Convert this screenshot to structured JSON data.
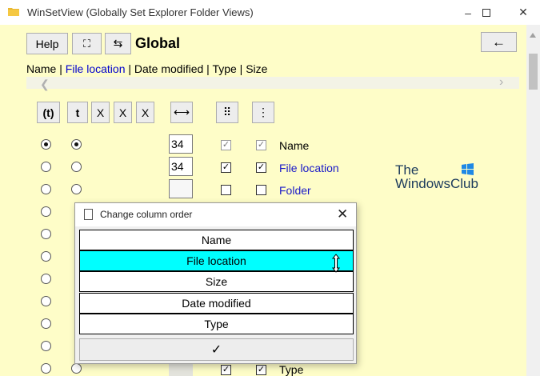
{
  "window": {
    "title": "WinSetView (Globally Set Explorer Folder Views)"
  },
  "toolbar": {
    "help_label": "Help",
    "fullscreen_glyph": "⛶",
    "swap_glyph": "⇆",
    "scope_label": "Global",
    "back_glyph": "←"
  },
  "column_header": {
    "name": "Name",
    "sep1": " | ",
    "file_location": "File location",
    "rest": " | Date modified | Type | Size"
  },
  "tools": {
    "t_paren": "(t)",
    "t_bold": "t",
    "x1": "X",
    "x2": "X",
    "x3": "X",
    "width": "⟷",
    "grid": "⠿",
    "more": "⋮"
  },
  "rows": [
    {
      "width": "34",
      "label": "Name"
    },
    {
      "width": "34",
      "label": "File location"
    },
    {
      "width": "",
      "label": "Folder"
    }
  ],
  "bottom_row_label": "Type",
  "logo": {
    "line1": "The",
    "line2": "WindowsClub"
  },
  "dialog": {
    "title": "Change column order",
    "items": [
      "Name",
      "File location",
      "Size",
      "Date modified",
      "Type"
    ],
    "selected_index": 1,
    "ok_glyph": "✓"
  }
}
